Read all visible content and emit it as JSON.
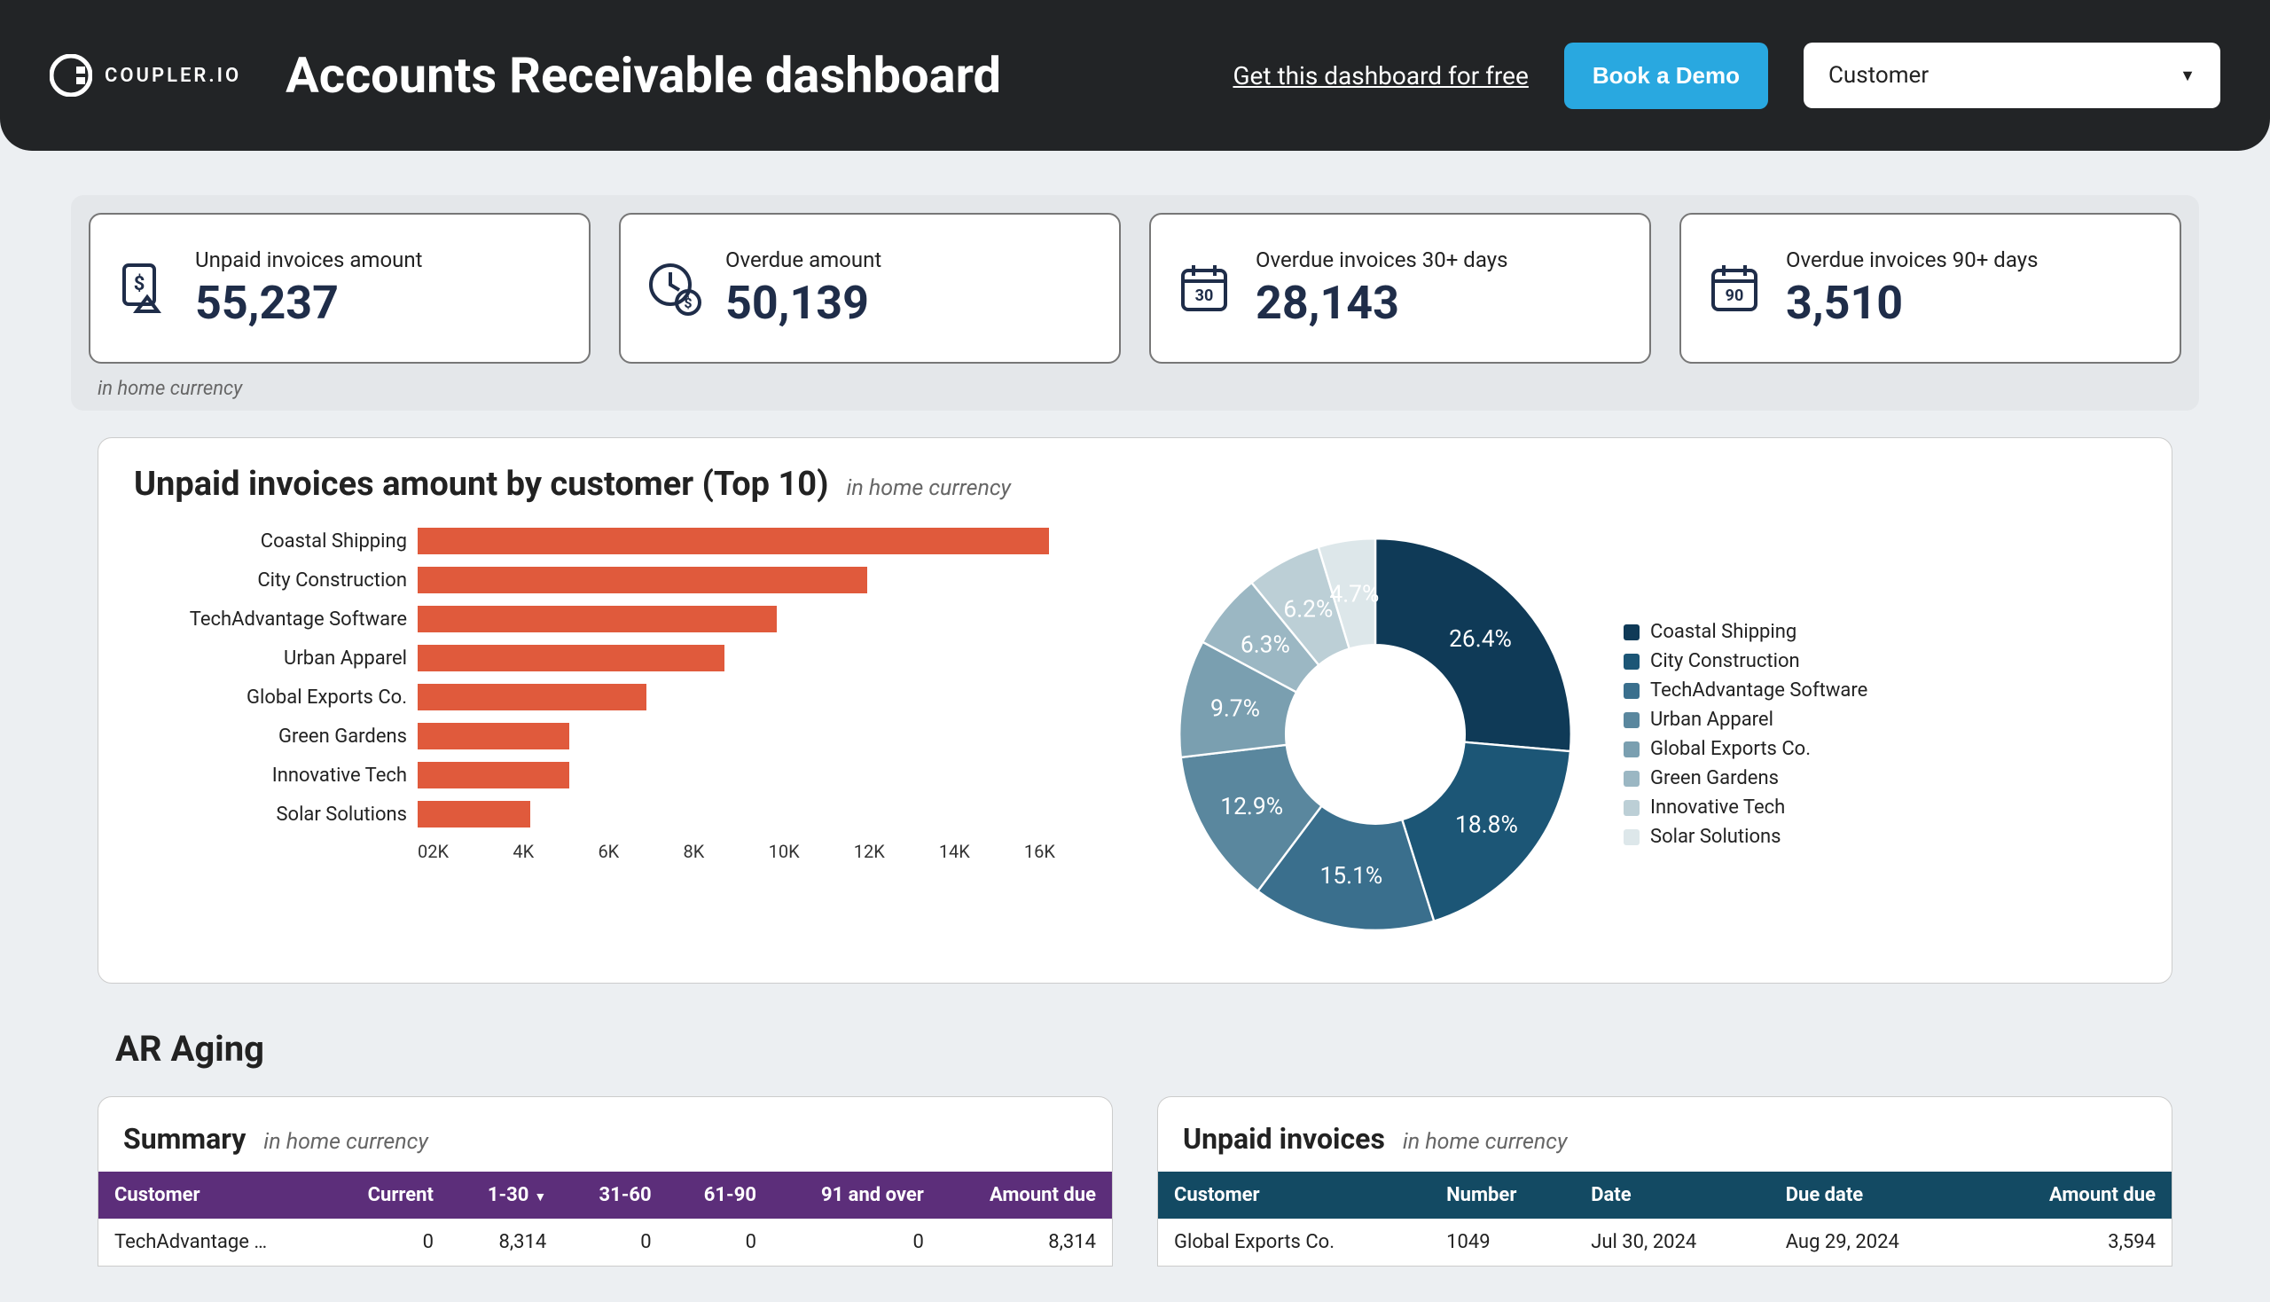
{
  "header": {
    "logo_text": "COUPLER.IO",
    "title": "Accounts Receivable dashboard",
    "get_link": "Get this dashboard for free",
    "demo_button": "Book a Demo",
    "filter_label": "Customer"
  },
  "kpi": {
    "note": "in home currency",
    "cards": [
      {
        "label": "Unpaid invoices amount",
        "value": "55,237"
      },
      {
        "label": "Overdue amount",
        "value": "50,139"
      },
      {
        "label": "Overdue invoices 30+ days",
        "value": "28,143"
      },
      {
        "label": "Overdue invoices 90+ days",
        "value": "3,510"
      }
    ]
  },
  "unpaid_by_customer": {
    "title": "Unpaid invoices amount by customer (Top 10)",
    "note": "in home currency"
  },
  "aging": {
    "heading": "AR Aging",
    "summary": {
      "title": "Summary",
      "note": "in home currency",
      "columns": [
        "Customer",
        "Current",
        "1-30",
        "31-60",
        "61-90",
        "91 and over",
        "Amount due"
      ],
      "rows": [
        {
          "customer": "TechAdvantage …",
          "current": "0",
          "b1": "8,314",
          "b2": "0",
          "b3": "0",
          "b4": "0",
          "due": "8,314"
        }
      ]
    },
    "unpaid": {
      "title": "Unpaid invoices",
      "note": "in home currency",
      "columns": [
        "Customer",
        "Number",
        "Date",
        "Due date",
        "Amount due"
      ],
      "rows": [
        {
          "customer": "Global Exports Co.",
          "number": "1049",
          "date": "Jul 30, 2024",
          "due_date": "Aug 29, 2024",
          "amount": "3,594"
        }
      ]
    }
  },
  "chart_data": [
    {
      "type": "bar",
      "orientation": "horizontal",
      "title": "Unpaid invoices amount by customer (Top 10)",
      "xlabel": "",
      "ylabel": "",
      "xlim": [
        0,
        16000
      ],
      "ticks": [
        "0",
        "2K",
        "4K",
        "6K",
        "8K",
        "10K",
        "12K",
        "14K",
        "16K"
      ],
      "categories": [
        "Coastal Shipping",
        "City Construction",
        "TechAdvantage Software",
        "Urban Apparel",
        "Global Exports Co.",
        "Green Gardens",
        "Innovative Tech",
        "Solar Solutions"
      ],
      "values": [
        14600,
        10400,
        8300,
        7100,
        5300,
        3500,
        3500,
        2600
      ],
      "color": "#e05a3c"
    },
    {
      "type": "pie",
      "subtype": "donut",
      "series": [
        {
          "name": "Coastal Shipping",
          "value": 26.4,
          "color": "#0f3a57"
        },
        {
          "name": "City Construction",
          "value": 18.8,
          "color": "#1c5676"
        },
        {
          "name": "TechAdvantage Software",
          "value": 15.1,
          "color": "#3a6f8d"
        },
        {
          "name": "Urban Apparel",
          "value": 12.9,
          "color": "#5a879e"
        },
        {
          "name": "Global Exports Co.",
          "value": 9.7,
          "color": "#7a9fb0"
        },
        {
          "name": "Green Gardens",
          "value": 6.3,
          "color": "#9bb7c3"
        },
        {
          "name": "Innovative Tech",
          "value": 6.2,
          "color": "#bccfd6"
        },
        {
          "name": "Solar Solutions",
          "value": 4.7,
          "color": "#dde7ea"
        }
      ]
    }
  ]
}
